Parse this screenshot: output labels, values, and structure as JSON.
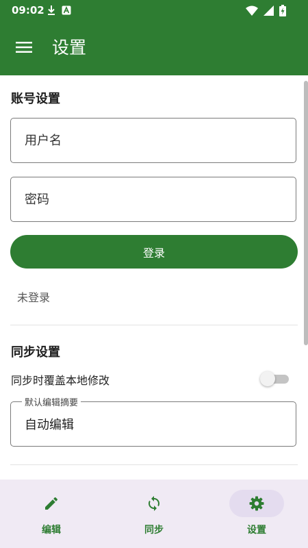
{
  "status_bar": {
    "time": "09:02"
  },
  "app_bar": {
    "title": "设置"
  },
  "account": {
    "title": "账号设置",
    "username_placeholder": "用户名",
    "password_placeholder": "密码",
    "login_label": "登录",
    "login_status": "未登录"
  },
  "sync": {
    "title": "同步设置",
    "overwrite_label": "同步时覆盖本地修改",
    "overwrite_enabled": false,
    "summary_legend": "默认编辑摘要",
    "summary_value": "自动编辑"
  },
  "bottom_nav": {
    "items": [
      {
        "label": "编辑",
        "icon": "pencil-icon"
      },
      {
        "label": "同步",
        "icon": "sync-icon"
      },
      {
        "label": "设置",
        "icon": "gear-icon",
        "active": true
      }
    ]
  },
  "colors": {
    "primary": "#2e7d32",
    "nav_background": "#f0eaf4",
    "nav_active_pill": "#e4dcef"
  }
}
